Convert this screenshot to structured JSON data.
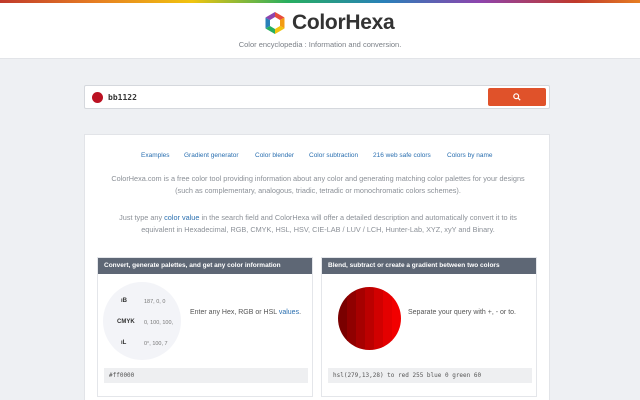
{
  "header": {
    "brand": "ColorHexa",
    "tagline": "Color encyclopedia : Information and conversion."
  },
  "search": {
    "value": "bb1122",
    "swatch_color": "#bb1122",
    "button_icon": "search-icon",
    "button_color": "#e0522a"
  },
  "nav": {
    "items": [
      "Examples",
      "Gradient generator",
      "Color blender",
      "Color subtraction",
      "216 web safe colors",
      "Colors by name"
    ]
  },
  "intro": {
    "para1": "ColorHexa.com is a free color tool providing information about any color and generating matching color palettes for your designs (such as complementary, analogous, triadic, tetradic or monochromatic colors schemes).",
    "para2_before": "Just type any ",
    "para2_link": "color value",
    "para2_after": " in the search field and ColorHexa will offer a detailed description and automatically convert it to its equivalent in Hexadecimal, RGB, CMYK, HSL, HSV, CIE-LAB / LUV / LCH, Hunter-Lab, XYZ, xyY and Binary."
  },
  "convert_card": {
    "title": "Convert, generate palettes, and get any color information",
    "rows": [
      {
        "label": "ıB",
        "value": "187, 0, 0"
      },
      {
        "label": "CMYK",
        "value": "0, 100, 100,"
      },
      {
        "label": "ıL",
        "value": "0°, 100, 7"
      }
    ],
    "text_before": "Enter any Hex, RGB or HSL ",
    "text_link": "values",
    "text_after": ".",
    "example": "#ff0000"
  },
  "blend_card": {
    "title": "Blend, subtract or create a gradient between two colors",
    "text": "Separate your query with +, - or to.",
    "example": "hsl(279,13,28) to red 255 blue 0 green 60",
    "stripe_colors": [
      "#7a0000",
      "#900000",
      "#a60000",
      "#bb0000",
      "#d10000",
      "#e40000",
      "#f20000"
    ]
  }
}
